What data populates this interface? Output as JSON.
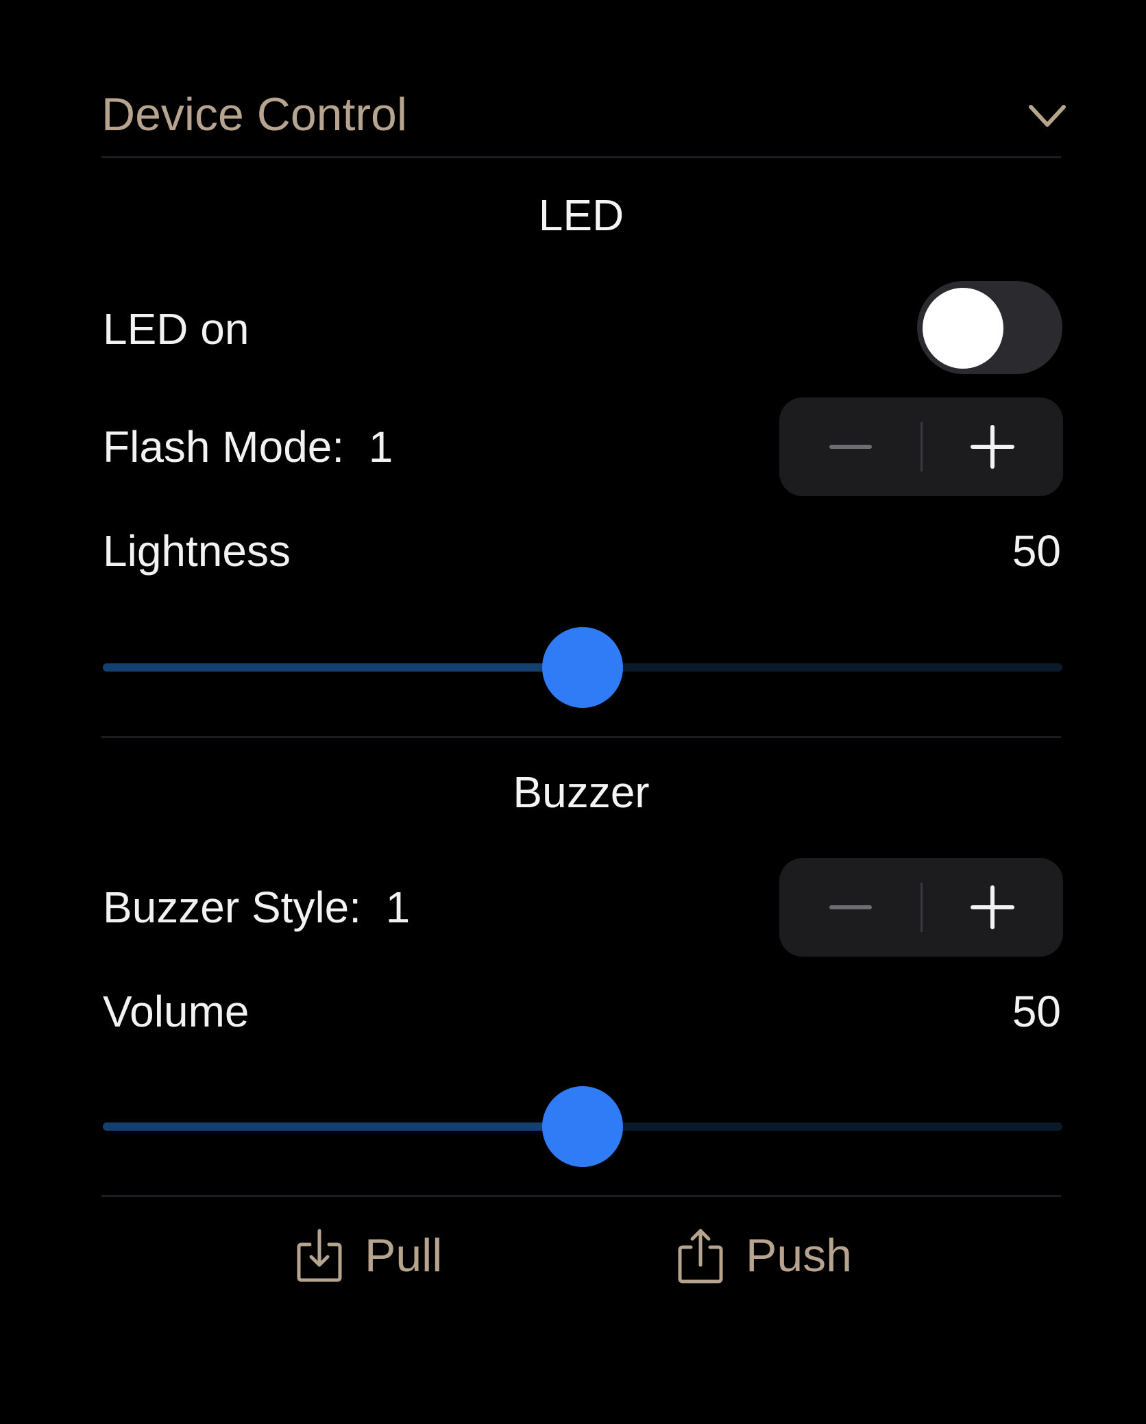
{
  "header": {
    "title": "Device Control",
    "chevron_icon": "chevron-down-icon",
    "accent_color": "#b7a48f"
  },
  "led": {
    "section_title": "LED",
    "led_on": {
      "label": "LED on",
      "value": false
    },
    "flash_mode": {
      "label": "Flash Mode:  1",
      "value": 1,
      "decrement_icon": "minus-icon",
      "increment_icon": "plus-icon"
    },
    "lightness": {
      "label": "Lightness",
      "value": "50",
      "fraction": 0.5
    }
  },
  "buzzer": {
    "section_title": "Buzzer",
    "buzzer_style": {
      "label": "Buzzer Style:  1",
      "value": 1,
      "decrement_icon": "minus-icon",
      "increment_icon": "plus-icon"
    },
    "volume": {
      "label": "Volume",
      "value": "50",
      "fraction": 0.5
    }
  },
  "actions": {
    "pull": {
      "label": "Pull",
      "icon": "download-tray-icon"
    },
    "push": {
      "label": "Push",
      "icon": "share-icon"
    }
  },
  "colors": {
    "background": "#000000",
    "slider_thumb": "#2f7cf6",
    "slider_fill": "#13406e"
  }
}
